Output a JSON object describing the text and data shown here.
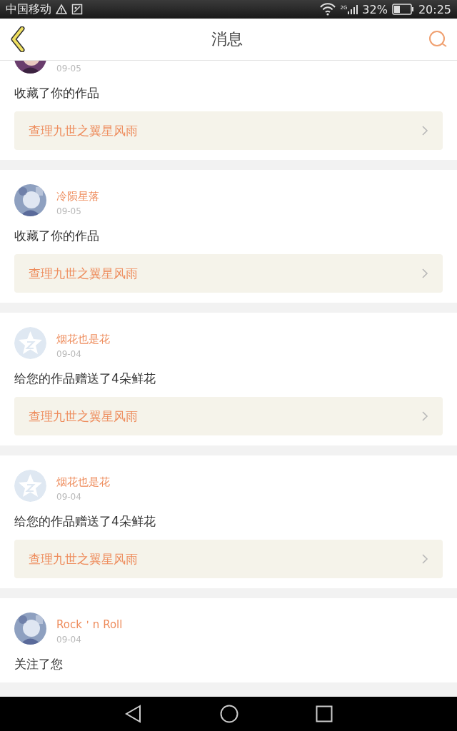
{
  "status_bar": {
    "carrier": "中国移动",
    "network": "2G",
    "battery": "32%",
    "time": "20:25"
  },
  "header": {
    "title": "消息"
  },
  "messages": [
    {
      "date": "09-05",
      "text": "收藏了你的作品",
      "link": "查理九世之翼星风雨"
    },
    {
      "name": "冷陨星落",
      "date": "09-05",
      "text": "收藏了你的作品",
      "link": "查理九世之翼星风雨"
    },
    {
      "avatar": {
        "kind": "default"
      },
      "name": "烟花也是花",
      "date": "09-04",
      "text": "给您的作品赠送了4朵鲜花",
      "link": "查理九世之翼星风雨"
    },
    {
      "avatar": {
        "kind": "default"
      },
      "name": "烟花也是花",
      "date": "09-04",
      "text": "给您的作品赠送了4朵鲜花",
      "link": "查理九世之翼星风雨"
    },
    {
      "name": "Rock＇n Roll",
      "date": "09-04",
      "text": "关注了您"
    }
  ]
}
